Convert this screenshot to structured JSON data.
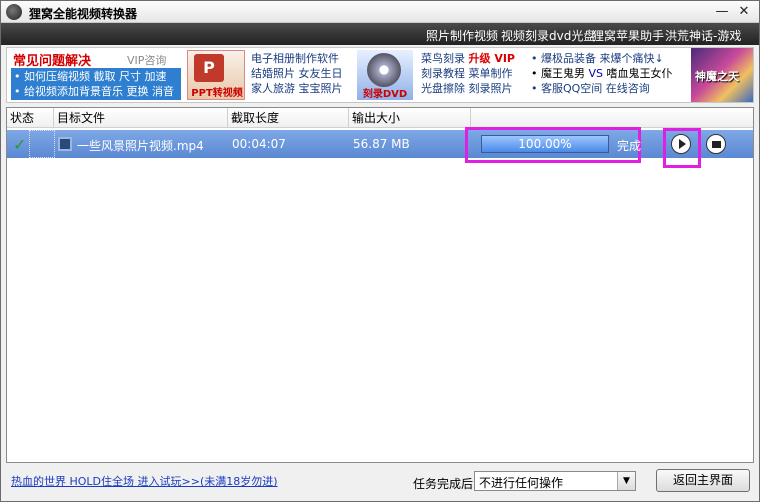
{
  "window": {
    "title": "狸窝全能视频转换器",
    "minimize": "—",
    "close": "✕"
  },
  "navbar": {
    "links": [
      "照片制作视频",
      "视频刻录dvd光盘",
      "狸窝苹果助手",
      "洪荒神话-游戏"
    ]
  },
  "banner": {
    "faq_title": "常见问题解决",
    "vip_link": "VIP咨询",
    "faq_line1": "• 如何压缩视频  截取  尺寸  加速",
    "faq_line2": "• 给视频添加背景音乐  更换  消音",
    "ppt_label": "PPT转视频",
    "album_links": [
      "电子相册制作软件",
      "结婚照片  女友生日",
      "家人旅游  宝宝照片"
    ],
    "dvd_label": "刻录DVD",
    "dvd_links_1": "菜鸟刻录",
    "dvd_links_1_hot": "升级 VIP",
    "dvd_links_2": "刻录教程  菜单制作",
    "dvd_links_3": "光盘擦除  刻录照片",
    "promo_1": "• 爆极品装备  来爆个痛快↓",
    "promo_2a": "• 魔王鬼男",
    "promo_2b": "VS",
    "promo_2c": "嗜血鬼王女仆",
    "promo_3": "• 客服QQ空间  在线咨询",
    "game_text": "神魔之天"
  },
  "table": {
    "headers": [
      "状态",
      "目标文件",
      "截取长度",
      "输出大小"
    ],
    "rows": [
      {
        "file": "一些风景照片视频.mp4",
        "duration": "00:04:07",
        "size": "56.87 MB",
        "progress_text": "100.00%",
        "progress": 1.0,
        "status": "完成"
      }
    ]
  },
  "bottom": {
    "ad_link": "热血的世界 HOLD住全场 进入试玩>>(未满18岁勿进)",
    "task_label": "任务完成后:",
    "task_option": "不进行任何操作",
    "back_button": "返回主界面"
  }
}
